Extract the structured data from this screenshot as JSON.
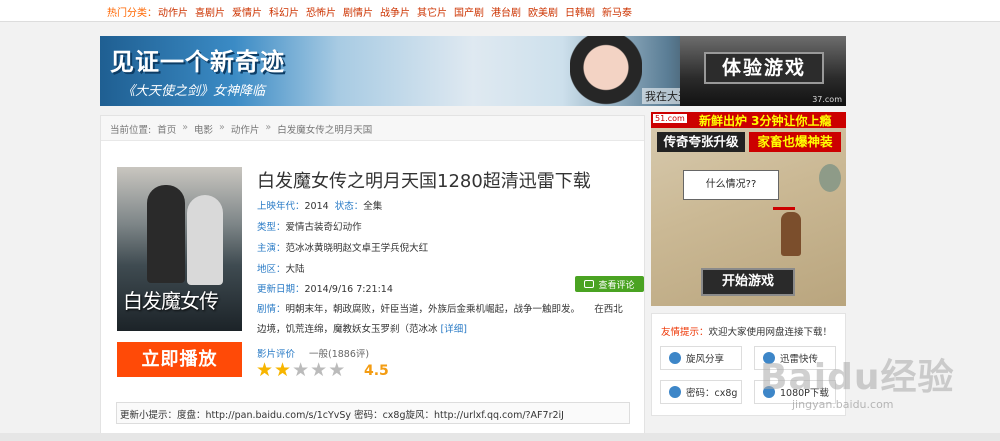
{
  "topnav": {
    "label": "热门分类：",
    "categories": [
      "动作片",
      "喜剧片",
      "爱情片",
      "科幻片",
      "恐怖片",
      "剧情片",
      "战争片",
      "其它片",
      "国产剧",
      "港台剧",
      "欧美剧",
      "日韩剧",
      "新马泰"
    ]
  },
  "banner": {
    "headline": "见证一个新奇迹",
    "subline": "《大天使之剑》女神降临",
    "caption": "我在大天使之剑等你",
    "button": "体验游戏",
    "site": "37.com"
  },
  "breadcrumb": {
    "prefix": "当前位置:",
    "items": [
      "首页",
      "电影",
      "动作片",
      "白发魔女传之明月天国"
    ],
    "separator": "»"
  },
  "movie": {
    "title": "白发魔女传之明月天国1280超清迅雷下载",
    "poster_title": "白发魔女传",
    "year_label": "上映年代：",
    "year": "2014",
    "status_label": "状态：",
    "status": "全集",
    "genre_label": "类型：",
    "genres": [
      "爱情",
      "古装",
      "奇幻",
      "动作"
    ],
    "cast_label": "主演：",
    "cast": [
      "范冰冰",
      "黄晓明",
      "赵文卓",
      "王学兵",
      "倪大红"
    ],
    "region_label": "地区：",
    "region": "大陆",
    "updated_label": "更新日期：",
    "updated": "2014/9/16 7:21:14",
    "plot_label": "剧情：",
    "plot": "明朝末年，朝政腐败，奸臣当道，外族后金乘机崛起，战争一触即发。　　在西北边境，饥荒连绵，魔教妖女玉罗刹（范冰冰",
    "plot_more": "[详细]",
    "comment_button": "查看评论",
    "play_button": "立即播放",
    "rating_label": "影片评价",
    "rating_count": "一般(1886评)",
    "rating_value": 2,
    "rating_max": 5,
    "score": "4.5",
    "tip": "更新小提示：度盘：http://pan.baidu.com/s/1cYvSy 密码：cx8g旋风：http://urlxf.qq.com/?AF7r2iJ"
  },
  "side_ad": {
    "site": "51.com",
    "headline": "新鲜出炉 3分钟让你上瘾",
    "left": "传奇夸张升级",
    "right": "家畜也爆神装",
    "bubble": "什么情况??",
    "start": "开始游戏"
  },
  "friend": {
    "label": "友情提示：",
    "text": "欢迎大家使用网盘连接下载！",
    "buttons": [
      "旋风分享",
      "迅雷快传",
      "密码：cx8g",
      "1080P下载"
    ]
  },
  "watermark": {
    "main": "Baidu经验",
    "sub": "jingyan.baidu.com"
  }
}
